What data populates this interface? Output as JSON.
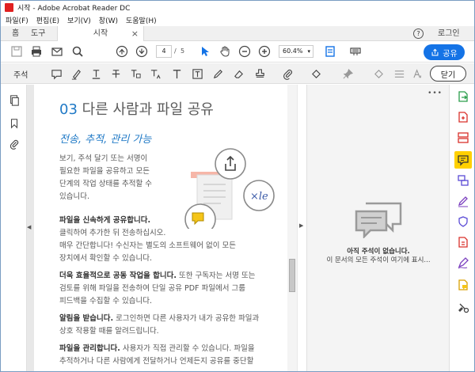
{
  "window": {
    "title": "시작 - Adobe Acrobat Reader DC"
  },
  "menu": [
    "파일(F)",
    "편집(E)",
    "보기(V)",
    "창(W)",
    "도움말(H)"
  ],
  "tabs": {
    "home": "홈",
    "tools": "도구",
    "doc": "시작",
    "close": "×",
    "help": "?",
    "login": "로그인"
  },
  "toolbar": {
    "page_current": "4",
    "page_sep": "/",
    "page_total": "5",
    "zoom": "60.4%",
    "share_label": "공유"
  },
  "comment_bar": {
    "label": "주석",
    "close_label": "닫기"
  },
  "doc": {
    "section_num": "03",
    "section_title": "다른 사람과 파일 공유",
    "subtitle": "전송, 추적, 관리 가능",
    "intro_lines": [
      "보기, 주석 달기 또는 서명이",
      "필요한 파일을 공유하고 모든",
      "단계의 작업 상태를 추적할 수",
      "있습니다."
    ],
    "p1_bold": "파일을 신속하게 공유합니다.",
    "p1_lines": [
      "클릭하여 추가한 뒤 전송하십시오.",
      "매우 간단합니다! 수신자는 별도의 소프트웨어 없이 모든",
      "장치에서 확인할 수 있습니다."
    ],
    "p2_bold": "더욱 효율적으로 공동 작업을 합니다.",
    "p2_rest": " 또한 구독자는 서명 또는",
    "p2_lines": [
      "검토를 위해 파일을 전송하여 단일 공유 PDF 파일에서 그룹",
      "피드백을 수집할 수 있습니다."
    ],
    "p3_bold": "알림을 받습니다.",
    "p3_rest": " 로그인하면 다른 사용자가 내가 공유한 파일과",
    "p3_lines": [
      "상호 작용할 때를 알려드립니다."
    ],
    "p4_bold": "파일을 관리합니다.",
    "p4_rest": " 사용자가 직접 관리할 수 있습니다. 파일을",
    "p4_lines": [
      "추적하거나 다른 사람에게 전달하거나 언제든지 공유를 중단할"
    ]
  },
  "comments_panel": {
    "more": "•••",
    "empty_title": "아직 주석이 없습니다.",
    "empty_desc": "이 문서의 모든 주석이 여기에 표시..."
  },
  "colors": {
    "accent": "#1473e6",
    "heading_blue": "#1f79c6"
  }
}
